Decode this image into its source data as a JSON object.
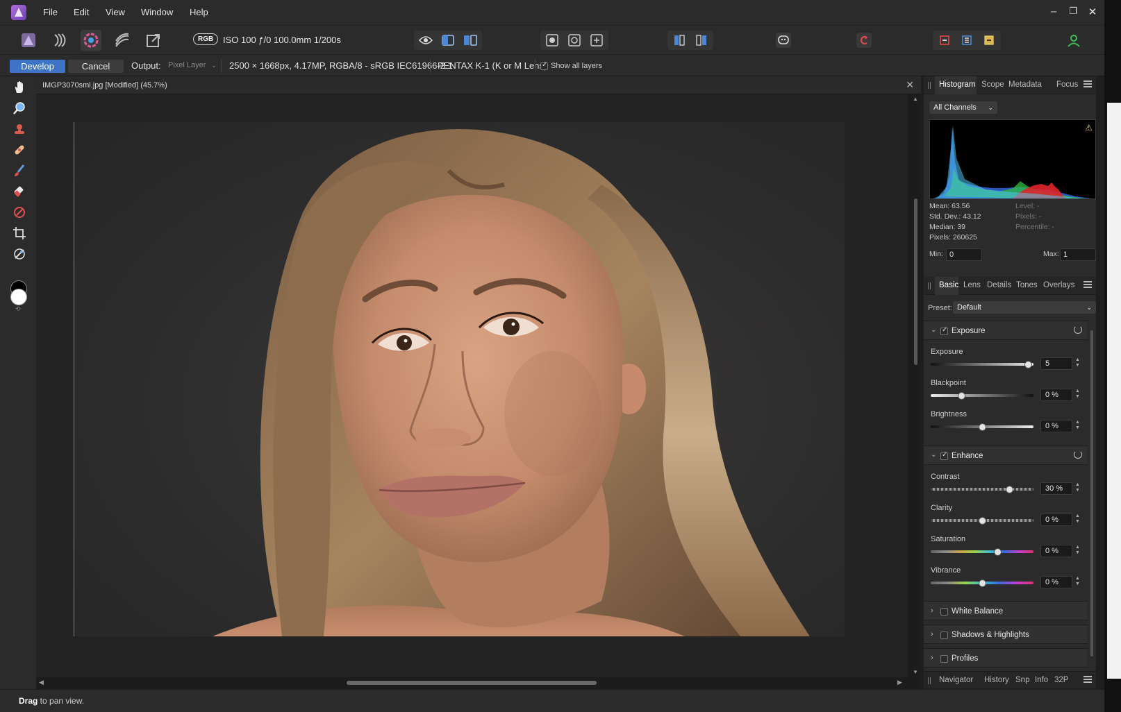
{
  "menubar": {
    "items": [
      "File",
      "Edit",
      "View",
      "Window",
      "Help"
    ]
  },
  "toolbar": {
    "color_mode": "RGB",
    "exif": "ISO 100 ƒ/0 100.0mm 1/200s"
  },
  "contextbar": {
    "develop_label": "Develop",
    "cancel_label": "Cancel",
    "output_label": "Output:",
    "output_value": "Pixel Layer",
    "image_info": "2500 × 1668px, 4.17MP, RGBA/8 - sRGB IEC61966-2.1",
    "camera": "PENTAX K-1 (K or M Lens)",
    "show_all_layers": "Show all layers"
  },
  "document": {
    "tab_title": "IMGP3070sml.jpg [Modified] (45.7%)"
  },
  "histogram_panel": {
    "tabs": [
      "Histogram",
      "Scope",
      "Metadata",
      "Focus"
    ],
    "channel": "All Channels",
    "mean": "Mean: 63.56",
    "std_dev": "Std. Dev.: 43.12",
    "median": "Median: 39",
    "pixels": "Pixels: 260625",
    "level": "Level: -",
    "level_pixels": "Pixels: -",
    "percentile": "Percentile: -",
    "min_label": "Min:",
    "min_value": "0",
    "max_label": "Max:",
    "max_value": "1"
  },
  "develop_panel": {
    "tabs": [
      "Basic",
      "Lens",
      "Details",
      "Tones",
      "Overlays"
    ],
    "preset_label": "Preset:",
    "preset_value": "Default",
    "exposure_section": {
      "title": "Exposure",
      "sliders": [
        {
          "label": "Exposure",
          "value": "5",
          "level": 0.95
        },
        {
          "label": "Blackpoint",
          "value": "0 %",
          "level": 0.3
        },
        {
          "label": "Brightness",
          "value": "0 %",
          "level": 0.5
        }
      ]
    },
    "enhance_section": {
      "title": "Enhance",
      "sliders": [
        {
          "label": "Contrast",
          "value": "30 %",
          "level": 0.77
        },
        {
          "label": "Clarity",
          "value": "0 %",
          "level": 0.5
        },
        {
          "label": "Saturation",
          "value": "0 %",
          "level": 0.65
        },
        {
          "label": "Vibrance",
          "value": "0 %",
          "level": 0.5
        }
      ]
    },
    "collapsed_sections": [
      "White Balance",
      "Shadows & Highlights",
      "Profiles"
    ]
  },
  "bottom_tabs": [
    "Navigator",
    "History",
    "Snp",
    "Info",
    "32P"
  ],
  "status": {
    "bold": "Drag",
    "text": " to pan view."
  },
  "colors": {
    "accent": "#3e74c6",
    "panel_bg": "#2b2b2b",
    "canvas_bg": "#232323"
  }
}
